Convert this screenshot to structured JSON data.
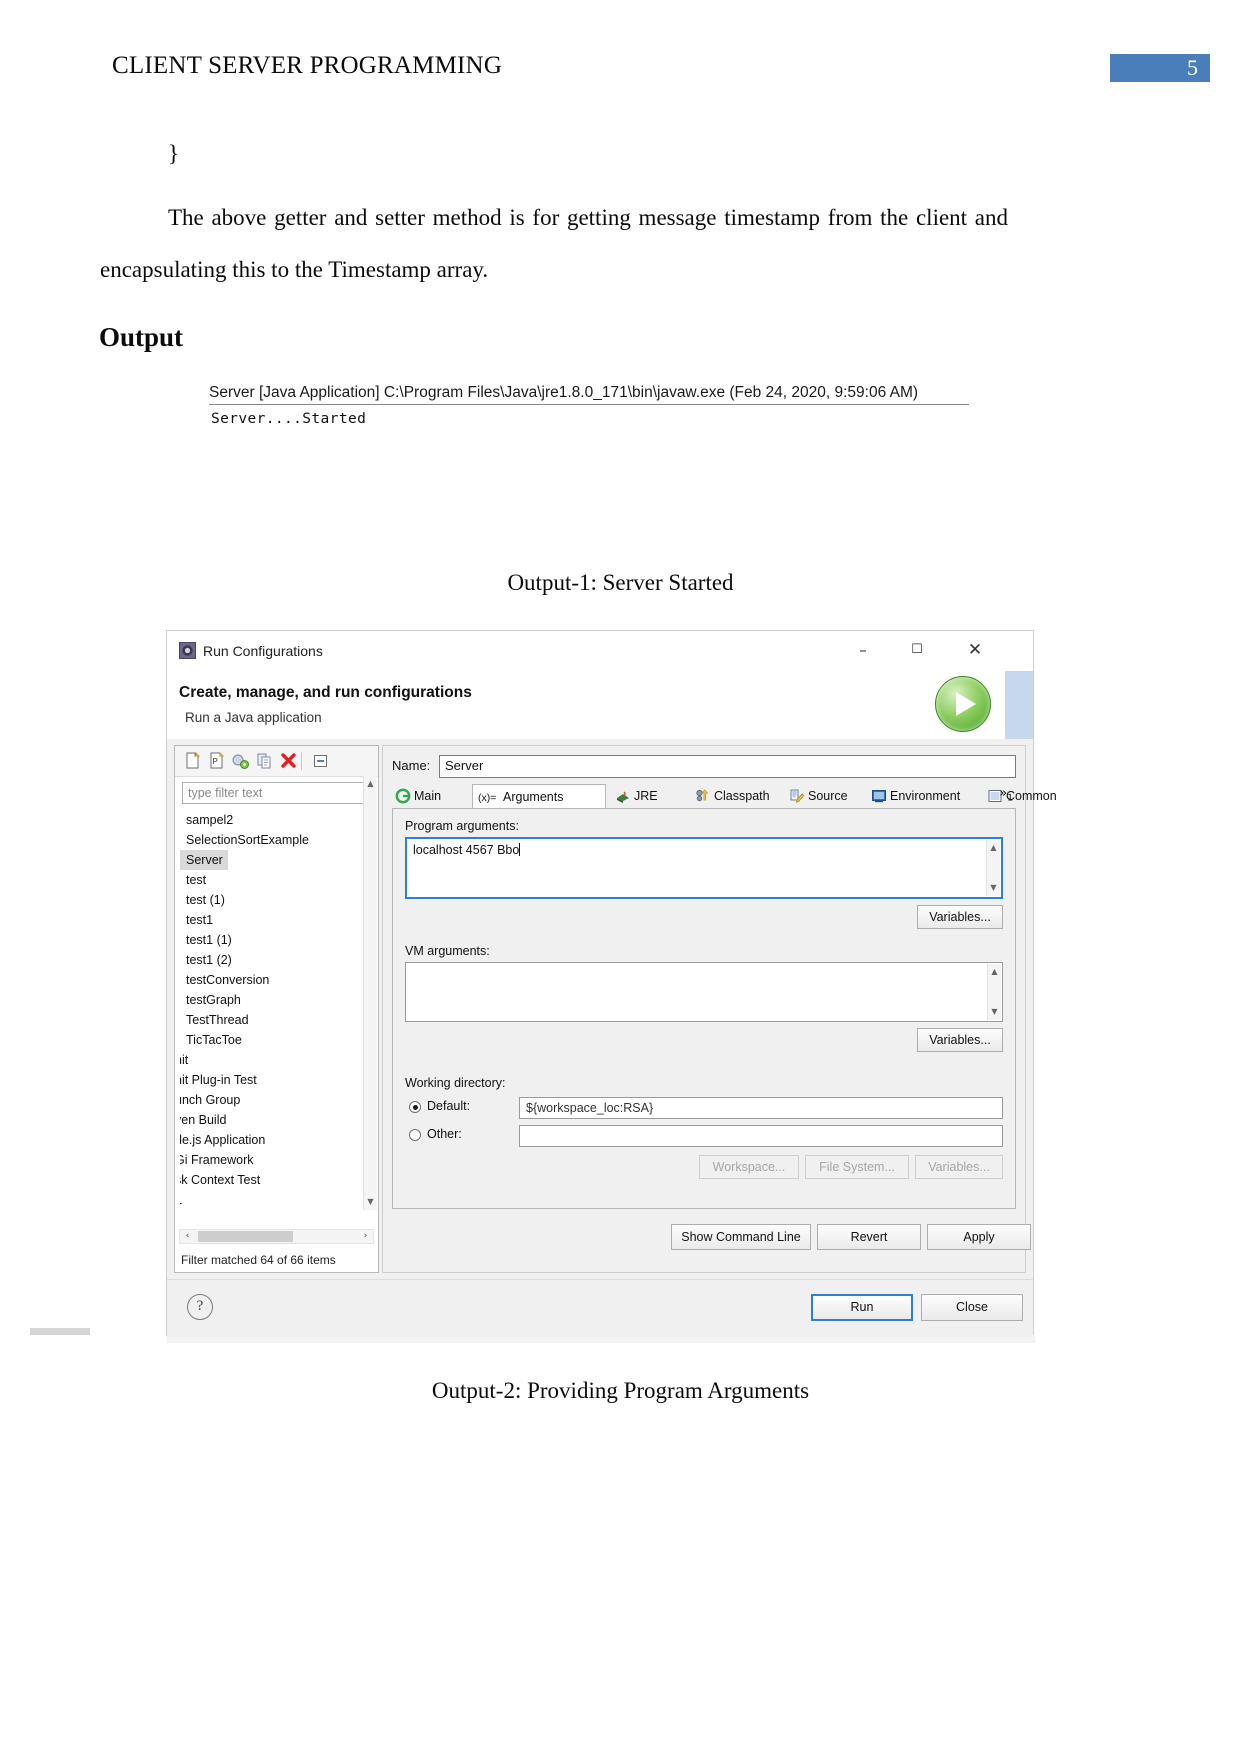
{
  "document": {
    "header_title": "CLIENT SERVER PROGRAMMING",
    "page_number": "5",
    "accent_color": "#4a7ebb",
    "code_brace": "}",
    "paragraph": "The above getter and setter method is for getting message timestamp from the client and encapsulating this to the Timestamp array.",
    "output_heading": "Output",
    "caption_1": "Output-1: Server Started",
    "caption_2": "Output-2: Providing Program Arguments"
  },
  "console": {
    "line1": "Server [Java Application] C:\\Program Files\\Java\\jre1.8.0_171\\bin\\javaw.exe (Feb 24, 2020, 9:59:06 AM)",
    "line2": "Server....Started"
  },
  "dialog": {
    "titlebar": {
      "icon": "run-configurations-icon",
      "title": "Run Configurations",
      "minimize": "–",
      "maximize": "☐",
      "close": "✕"
    },
    "heading": "Create, manage, and run configurations",
    "subheading": "Run a Java application",
    "big_icon": "run-play-icon",
    "tree": {
      "toolbar_icons": [
        "new-configuration-icon",
        "new-prototype-icon",
        "export-icon",
        "duplicate-icon",
        "delete-icon",
        "collapse-all-icon"
      ],
      "filter_placeholder": "type filter text",
      "items": [
        {
          "label": "sampel2",
          "selected": false,
          "clipped": false
        },
        {
          "label": "SelectionSortExample",
          "selected": false,
          "clipped": false
        },
        {
          "label": "Server",
          "selected": true,
          "clipped": false
        },
        {
          "label": "test",
          "selected": false,
          "clipped": false
        },
        {
          "label": "test (1)",
          "selected": false,
          "clipped": false
        },
        {
          "label": "test1",
          "selected": false,
          "clipped": false
        },
        {
          "label": "test1 (1)",
          "selected": false,
          "clipped": false
        },
        {
          "label": "test1 (2)",
          "selected": false,
          "clipped": false
        },
        {
          "label": "testConversion",
          "selected": false,
          "clipped": false
        },
        {
          "label": "testGraph",
          "selected": false,
          "clipped": false
        },
        {
          "label": "TestThread",
          "selected": false,
          "clipped": false
        },
        {
          "label": "TicTacToe",
          "selected": false,
          "clipped": false
        },
        {
          "label": "nit",
          "selected": false,
          "clipped": true
        },
        {
          "label": "nit Plug-in Test",
          "selected": false,
          "clipped": true
        },
        {
          "label": "unch Group",
          "selected": false,
          "clipped": true
        },
        {
          "label": "ven Build",
          "selected": false,
          "clipped": true
        },
        {
          "label": "de.js Application",
          "selected": false,
          "clipped": true
        },
        {
          "label": "Gi Framework",
          "selected": false,
          "clipped": true
        },
        {
          "label": "sk Context Test",
          "selected": false,
          "clipped": true
        },
        {
          "label": "L",
          "selected": false,
          "clipped": true
        }
      ],
      "status": "Filter matched 64 of 66 items",
      "scroll_left_arrow": "‹",
      "scroll_right_arrow": "›",
      "scroll_up_arrow": "▲",
      "scroll_down_arrow": "▼"
    },
    "name_label": "Name:",
    "name_value": "Server",
    "tabs": [
      {
        "label": "Main",
        "icon": "main-tab-icon",
        "active": false
      },
      {
        "label": "Arguments",
        "icon": "arguments-tab-icon",
        "active": true
      },
      {
        "label": "JRE",
        "icon": "jre-tab-icon",
        "active": false
      },
      {
        "label": "Classpath",
        "icon": "classpath-tab-icon",
        "active": false
      },
      {
        "label": "Source",
        "icon": "source-tab-icon",
        "active": false
      },
      {
        "label": "Environment",
        "icon": "environment-tab-icon",
        "active": false
      },
      {
        "label": "Common",
        "icon": "common-tab-icon",
        "active": false
      }
    ],
    "tabs_overflow": "»",
    "tabs_overflow_count": "1",
    "arguments_tab": {
      "program_args_label": "Program arguments:",
      "program_args_value": "localhost 4567 Bbo",
      "program_args_variables_button": "Variables...",
      "vm_args_label": "VM arguments:",
      "vm_args_value": "",
      "vm_args_variables_button": "Variables...",
      "working_dir_label": "Working directory:",
      "default_radio_label": "Default:",
      "default_radio_selected": true,
      "default_value": "${workspace_loc:RSA}",
      "other_radio_label": "Other:",
      "other_radio_selected": false,
      "other_value": "",
      "workspace_button": "Workspace...",
      "file_system_button": "File System...",
      "variables_button": "Variables..."
    },
    "footer_actions": {
      "show_command_line": "Show Command Line",
      "revert": "Revert",
      "apply": "Apply"
    },
    "bottom_actions": {
      "help": "?",
      "run": "Run",
      "close": "Close"
    }
  }
}
